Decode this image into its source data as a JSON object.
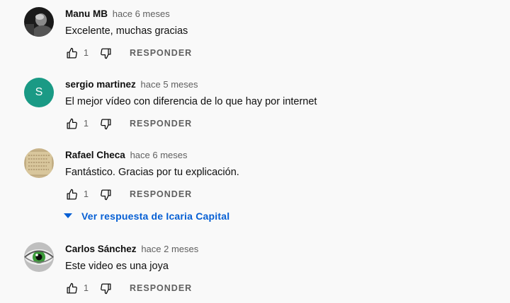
{
  "comments": [
    {
      "author": "Manu MB",
      "time": "hace 6 meses",
      "text": "Excelente, muchas gracias",
      "likes": "1",
      "avatar": "photo-dark"
    },
    {
      "author": "sergio martinez",
      "time": "hace 5 meses",
      "text": "El mejor vídeo con diferencia de lo que hay por internet",
      "likes": "1",
      "avatar": "letter",
      "avatar_letter": "S",
      "avatar_color": "#1a9a85"
    },
    {
      "author": "Rafael Checa",
      "time": "hace 6 meses",
      "text": "Fantástico. Gracias por tu explicación.",
      "likes": "1",
      "avatar": "photo-parchment"
    },
    {
      "author": "Carlos Sánchez",
      "time": "hace 2 meses",
      "text": "Este video es una joya",
      "likes": "1",
      "avatar": "photo-eye"
    }
  ],
  "reply_label": "RESPONDER",
  "view_replies": "Ver respuesta de Icaria Capital",
  "colors": {
    "link": "#065fd4",
    "meta": "#606060",
    "background": "#f9f9f9"
  },
  "icons": [
    "thumb-up-icon",
    "thumb-down-icon",
    "caret-down-icon"
  ]
}
